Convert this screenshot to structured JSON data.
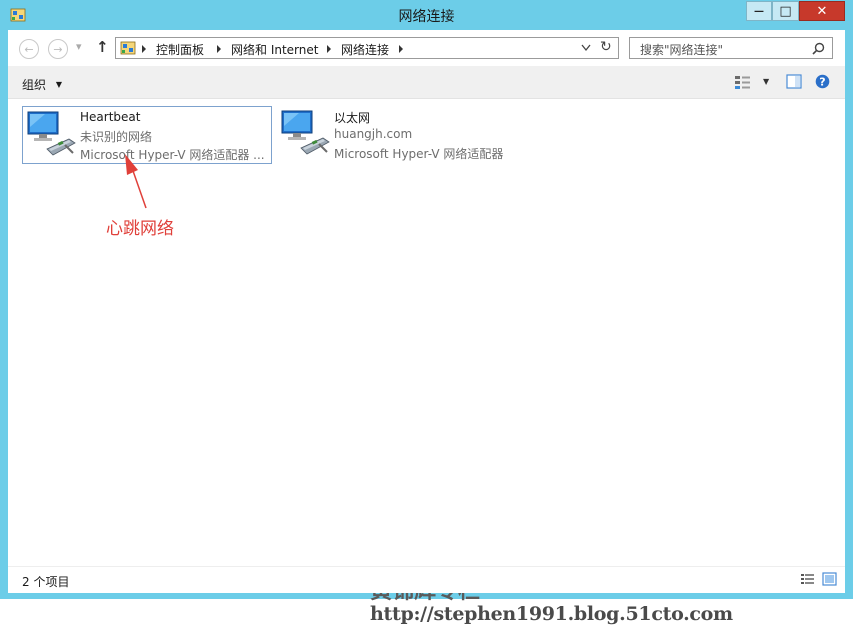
{
  "window": {
    "title": "网络连接",
    "minimize_glyph": "—",
    "maximize_glyph": "□",
    "close_glyph": "✕"
  },
  "nav": {
    "back_glyph": "←",
    "forward_glyph": "→",
    "recent_glyph": "▾",
    "up_glyph": "↑",
    "breadcrumb": [
      "控制面板",
      "网络和 Internet",
      "网络连接"
    ],
    "refresh_glyph": "↻"
  },
  "search": {
    "placeholder": "搜索\"网络连接\""
  },
  "toolbar": {
    "organize_label": "组织",
    "dropdown_glyph": "▼"
  },
  "connections": [
    {
      "name": "Heartbeat",
      "status": "未识别的网络",
      "adapter": "Microsoft Hyper-V 网络适配器 ..."
    },
    {
      "name": "以太网",
      "status": "huangjh.com",
      "adapter": "Microsoft Hyper-V 网络适配器"
    }
  ],
  "annotation": "心跳网络",
  "watermark": {
    "title": "黄锦辉专栏",
    "url": "http://stephen1991.blog.51cto.com"
  },
  "status": {
    "item_count": "2 个项目"
  },
  "colors": {
    "accent": "#6ccde8",
    "close": "#c7392b",
    "annotation": "#e0403a"
  }
}
